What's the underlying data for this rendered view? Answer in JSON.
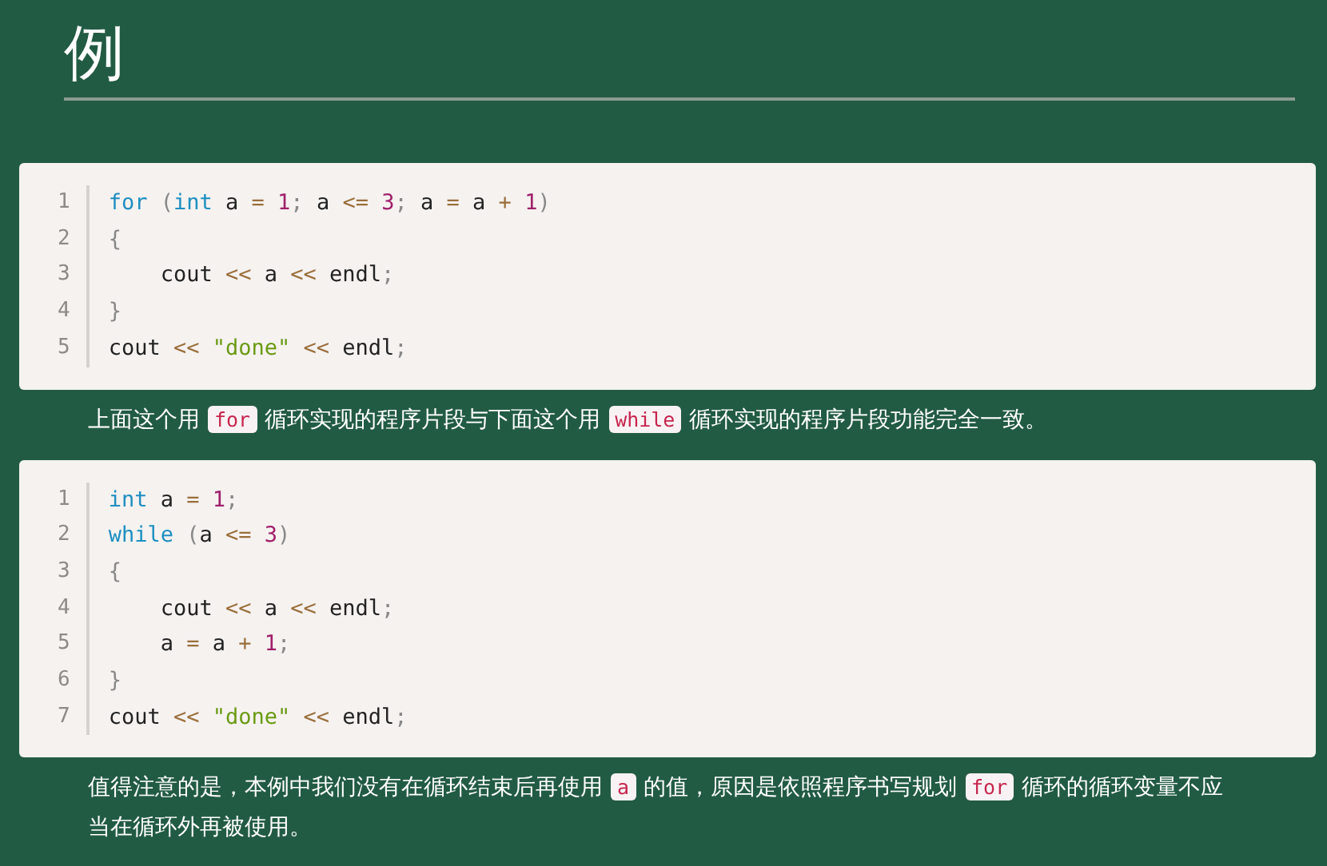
{
  "heading": "例",
  "blocks": [
    {
      "kind": "code",
      "lines": [
        {
          "number": "1",
          "tokens": [
            {
              "kind": "keyword",
              "text": "for"
            },
            {
              "kind": "punct",
              "text": " ("
            },
            {
              "kind": "keyword",
              "text": "int"
            },
            {
              "kind": "plain",
              "text": " a "
            },
            {
              "kind": "operator",
              "text": "= "
            },
            {
              "kind": "number",
              "text": "1"
            },
            {
              "kind": "punct",
              "text": ";"
            },
            {
              "kind": "plain",
              "text": " a "
            },
            {
              "kind": "operator",
              "text": "<= "
            },
            {
              "kind": "number",
              "text": "3"
            },
            {
              "kind": "punct",
              "text": ";"
            },
            {
              "kind": "plain",
              "text": " a "
            },
            {
              "kind": "operator",
              "text": "="
            },
            {
              "kind": "plain",
              "text": " a "
            },
            {
              "kind": "operator",
              "text": "+ "
            },
            {
              "kind": "number",
              "text": "1"
            },
            {
              "kind": "punct",
              "text": ")"
            }
          ]
        },
        {
          "number": "2",
          "tokens": [
            {
              "kind": "punct",
              "text": "{"
            }
          ]
        },
        {
          "number": "3",
          "tokens": [
            {
              "kind": "plain",
              "text": "    cout "
            },
            {
              "kind": "operator",
              "text": "<<"
            },
            {
              "kind": "plain",
              "text": " a "
            },
            {
              "kind": "operator",
              "text": "<<"
            },
            {
              "kind": "plain",
              "text": " endl"
            },
            {
              "kind": "punct",
              "text": ";"
            }
          ]
        },
        {
          "number": "4",
          "tokens": [
            {
              "kind": "punct",
              "text": "}"
            }
          ]
        },
        {
          "number": "5",
          "tokens": [
            {
              "kind": "plain",
              "text": "cout "
            },
            {
              "kind": "operator",
              "text": "<< "
            },
            {
              "kind": "string",
              "text": "\"done\" "
            },
            {
              "kind": "operator",
              "text": "<<"
            },
            {
              "kind": "plain",
              "text": " endl"
            },
            {
              "kind": "punct",
              "text": ";"
            }
          ]
        }
      ]
    },
    {
      "kind": "paragraph",
      "segments": [
        {
          "kind": "text",
          "text": "上面这个用"
        },
        {
          "kind": "code",
          "text": "for"
        },
        {
          "kind": "text",
          "text": "循环实现的程序片段与下面这个用"
        },
        {
          "kind": "code",
          "text": "while"
        },
        {
          "kind": "text",
          "text": "循环实现的程序片段功能完全一致。"
        }
      ]
    },
    {
      "kind": "code",
      "lines": [
        {
          "number": "1",
          "tokens": [
            {
              "kind": "keyword",
              "text": "int"
            },
            {
              "kind": "plain",
              "text": " a "
            },
            {
              "kind": "operator",
              "text": "= "
            },
            {
              "kind": "number",
              "text": "1"
            },
            {
              "kind": "punct",
              "text": ";"
            }
          ]
        },
        {
          "number": "2",
          "tokens": [
            {
              "kind": "keyword",
              "text": "while"
            },
            {
              "kind": "punct",
              "text": " ("
            },
            {
              "kind": "plain",
              "text": "a "
            },
            {
              "kind": "operator",
              "text": "<= "
            },
            {
              "kind": "number",
              "text": "3"
            },
            {
              "kind": "punct",
              "text": ")"
            }
          ]
        },
        {
          "number": "3",
          "tokens": [
            {
              "kind": "punct",
              "text": "{"
            }
          ]
        },
        {
          "number": "4",
          "tokens": [
            {
              "kind": "plain",
              "text": "    cout "
            },
            {
              "kind": "operator",
              "text": "<<"
            },
            {
              "kind": "plain",
              "text": " a "
            },
            {
              "kind": "operator",
              "text": "<<"
            },
            {
              "kind": "plain",
              "text": " endl"
            },
            {
              "kind": "punct",
              "text": ";"
            }
          ]
        },
        {
          "number": "5",
          "tokens": [
            {
              "kind": "plain",
              "text": "    a "
            },
            {
              "kind": "operator",
              "text": "="
            },
            {
              "kind": "plain",
              "text": " a "
            },
            {
              "kind": "operator",
              "text": "+ "
            },
            {
              "kind": "number",
              "text": "1"
            },
            {
              "kind": "punct",
              "text": ";"
            }
          ]
        },
        {
          "number": "6",
          "tokens": [
            {
              "kind": "punct",
              "text": "}"
            }
          ]
        },
        {
          "number": "7",
          "tokens": [
            {
              "kind": "plain",
              "text": "cout "
            },
            {
              "kind": "operator",
              "text": "<< "
            },
            {
              "kind": "string",
              "text": "\"done\" "
            },
            {
              "kind": "operator",
              "text": "<<"
            },
            {
              "kind": "plain",
              "text": " endl"
            },
            {
              "kind": "punct",
              "text": ";"
            }
          ]
        }
      ]
    },
    {
      "kind": "paragraph",
      "segments": [
        {
          "kind": "text",
          "text": "值得注意的是，本例中我们没有在循环结束后再使用"
        },
        {
          "kind": "code",
          "text": "a"
        },
        {
          "kind": "text",
          "text": "的值，原因是依照程序书写规划"
        },
        {
          "kind": "code",
          "text": "for"
        },
        {
          "kind": "text",
          "text": "循环的循环变量不应"
        },
        {
          "kind": "text",
          "text": "当在循环外再被使用。"
        }
      ]
    }
  ]
}
